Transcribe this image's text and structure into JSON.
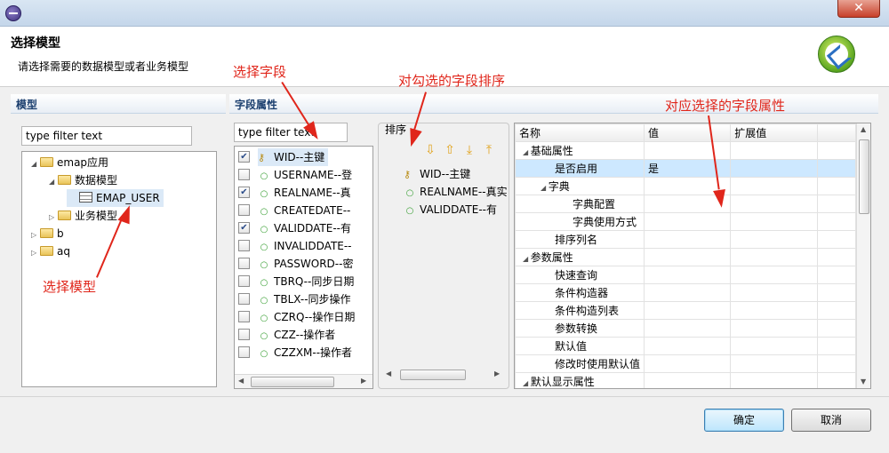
{
  "dialog": {
    "title": "选择模型",
    "description": "请选择需要的数据模型或者业务模型",
    "close_label": "✕"
  },
  "model_panel": {
    "title": "模型",
    "filter_placeholder": "type filter text",
    "tree": [
      {
        "label": "emap应用",
        "level": 0,
        "expanded": true,
        "icon": "folder-icon"
      },
      {
        "label": "数据模型",
        "level": 1,
        "expanded": true,
        "icon": "folder-icon"
      },
      {
        "label": "EMAP_USER",
        "level": 2,
        "icon": "table-icon",
        "selected": true
      },
      {
        "label": "业务模型",
        "level": 1,
        "expanded": false,
        "icon": "folder-icon"
      },
      {
        "label": "b",
        "level": 0,
        "expanded": false,
        "icon": "folder-icon"
      },
      {
        "label": "aq",
        "level": 0,
        "expanded": false,
        "icon": "folder-icon"
      }
    ]
  },
  "field_panel": {
    "title": "字段属性",
    "filter_placeholder": "type filter text",
    "fields": [
      {
        "label": "WID--主键",
        "checked": true,
        "icon": "key-icon",
        "selected": true
      },
      {
        "label": "USERNAME--登",
        "checked": false,
        "icon": "field-icon"
      },
      {
        "label": "REALNAME--真",
        "checked": true,
        "icon": "field-icon"
      },
      {
        "label": "CREATEDATE--",
        "checked": false,
        "icon": "field-icon"
      },
      {
        "label": "VALIDDATE--有",
        "checked": true,
        "icon": "field-icon"
      },
      {
        "label": "INVALIDDATE--",
        "checked": false,
        "icon": "field-icon"
      },
      {
        "label": "PASSWORD--密",
        "checked": false,
        "icon": "field-icon"
      },
      {
        "label": "TBRQ--同步日期",
        "checked": false,
        "icon": "field-icon"
      },
      {
        "label": "TBLX--同步操作",
        "checked": false,
        "icon": "field-icon"
      },
      {
        "label": "CZRQ--操作日期",
        "checked": false,
        "icon": "field-icon"
      },
      {
        "label": "CZZ--操作者",
        "checked": false,
        "icon": "field-icon"
      },
      {
        "label": "CZZXM--操作者",
        "checked": false,
        "icon": "field-icon"
      }
    ]
  },
  "sort_panel": {
    "title": "排序",
    "buttons": [
      "move-down-icon",
      "move-up-icon",
      "move-bottom-icon",
      "move-top-icon"
    ],
    "items": [
      {
        "label": "WID--主键",
        "icon": "key-icon"
      },
      {
        "label": "REALNAME--真实",
        "icon": "field-icon"
      },
      {
        "label": "VALIDDATE--有",
        "icon": "field-icon"
      }
    ]
  },
  "properties": {
    "columns": [
      "名称",
      "值",
      "扩展值"
    ],
    "rows": [
      {
        "name": "基础属性",
        "value": "",
        "level": 0,
        "group": true
      },
      {
        "name": "是否启用",
        "value": "是",
        "level": 1,
        "selected": true
      },
      {
        "name": "字典",
        "value": "",
        "level": 1,
        "group": true
      },
      {
        "name": "字典配置",
        "value": "",
        "level": 2
      },
      {
        "name": "字典使用方式",
        "value": "",
        "level": 2
      },
      {
        "name": "排序列名",
        "value": "",
        "level": 1
      },
      {
        "name": "参数属性",
        "value": "",
        "level": 0,
        "group": true
      },
      {
        "name": "快速查询",
        "value": "",
        "level": 1
      },
      {
        "name": "条件构造器",
        "value": "",
        "level": 1
      },
      {
        "name": "条件构造列表",
        "value": "",
        "level": 1
      },
      {
        "name": "参数转换",
        "value": "",
        "level": 1
      },
      {
        "name": "默认值",
        "value": "",
        "level": 1
      },
      {
        "name": "修改时使用默认值",
        "value": "",
        "level": 1
      },
      {
        "name": "默认显示属性",
        "value": "",
        "level": 0,
        "group": true
      }
    ]
  },
  "buttons": {
    "ok": "确定",
    "cancel": "取消"
  },
  "annotations": {
    "select_model": "选择模型",
    "select_field": "选择字段",
    "sort_checked": "对勾选的字段排序",
    "field_props": "对应选择的字段属性"
  },
  "colors": {
    "annotation": "#e0261b",
    "selection": "#cde8ff"
  }
}
